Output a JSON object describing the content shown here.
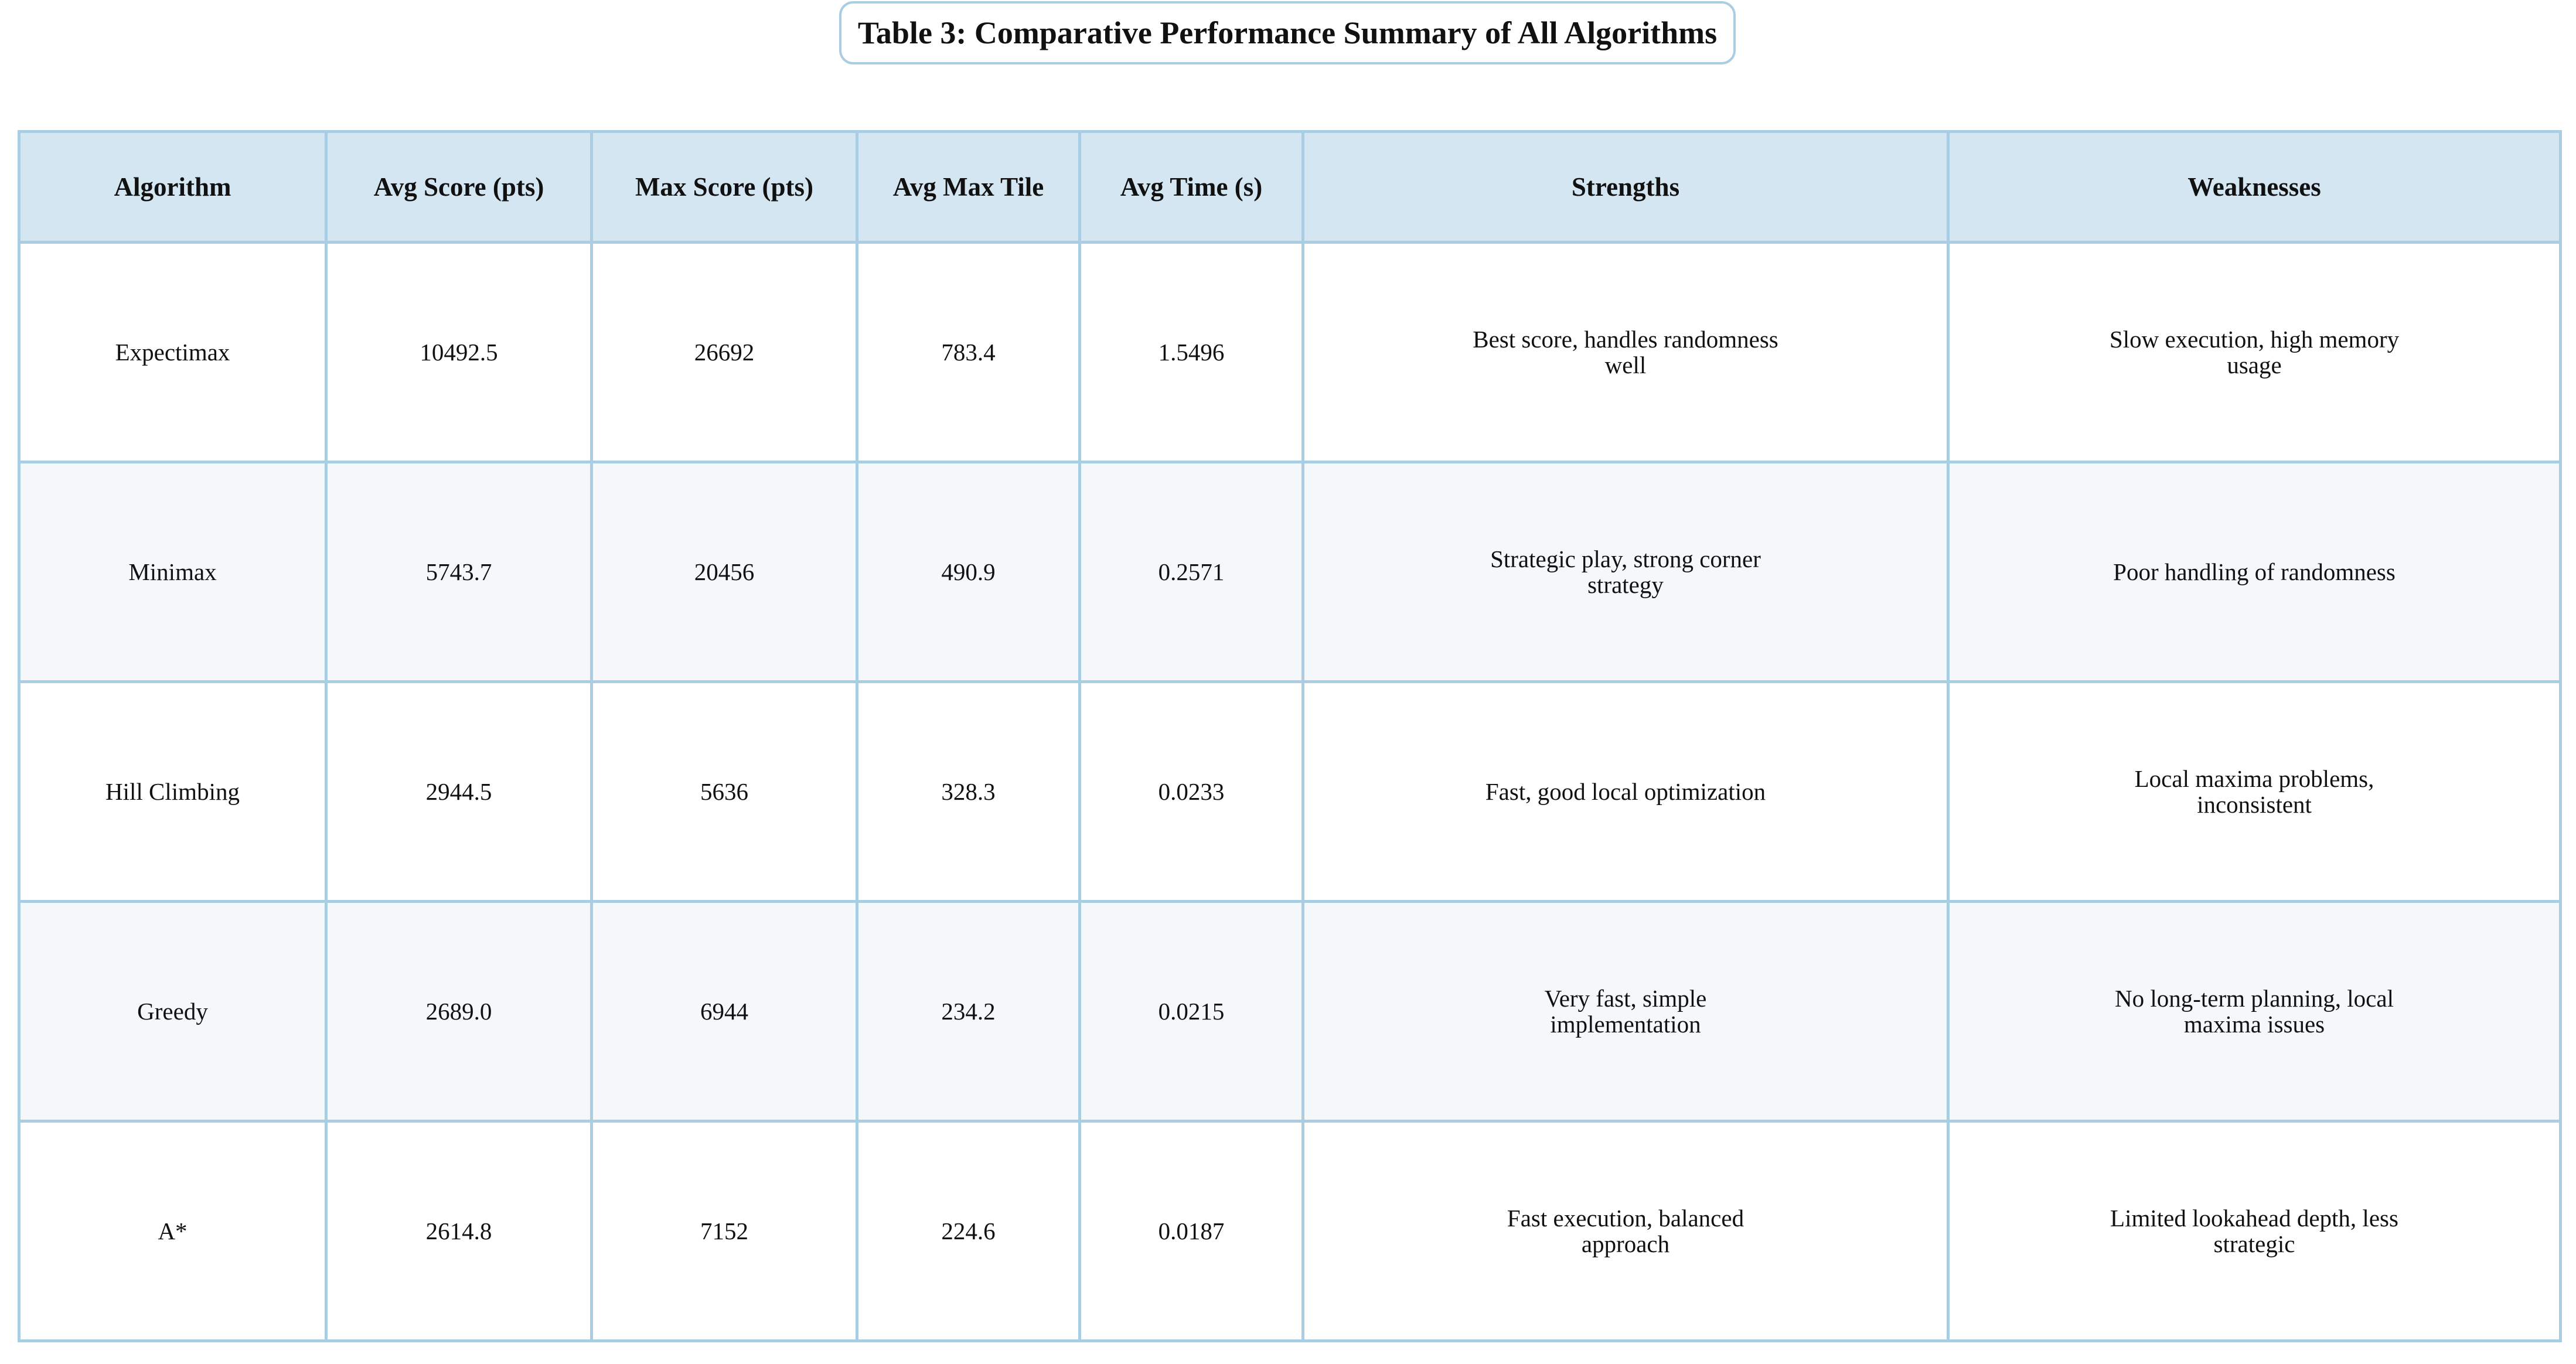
{
  "title": "Table 3: Comparative Performance Summary of All Algorithms",
  "colors": {
    "border": "#a9cde3",
    "header_bg": "#d5e6f3",
    "alt_row_bg": "#f4f8fb"
  },
  "table": {
    "headers": [
      "Algorithm",
      "Avg Score (pts)",
      "Max Score (pts)",
      "Avg Max Tile",
      "Avg Time (s)",
      "Strengths",
      "Weaknesses"
    ],
    "rows": [
      {
        "algorithm": "Expectimax",
        "avg_score": "10492.5",
        "max_score": "26692",
        "avg_max_tile": "783.4",
        "avg_time": "1.5496",
        "strengths": "Best score, handles randomness well",
        "weaknesses": "Slow execution, high memory usage"
      },
      {
        "algorithm": "Minimax",
        "avg_score": "5743.7",
        "max_score": "20456",
        "avg_max_tile": "490.9",
        "avg_time": "0.2571",
        "strengths": "Strategic play, strong corner strategy",
        "weaknesses": "Poor handling of randomness"
      },
      {
        "algorithm": "Hill Climbing",
        "avg_score": "2944.5",
        "max_score": "5636",
        "avg_max_tile": "328.3",
        "avg_time": "0.0233",
        "strengths": "Fast, good local optimization",
        "weaknesses": "Local maxima problems, inconsistent"
      },
      {
        "algorithm": "Greedy",
        "avg_score": "2689.0",
        "max_score": "6944",
        "avg_max_tile": "234.2",
        "avg_time": "0.0215",
        "strengths": "Very fast, simple implementation",
        "weaknesses": "No long-term planning, local maxima issues"
      },
      {
        "algorithm": "A*",
        "avg_score": "2614.8",
        "max_score": "7152",
        "avg_max_tile": "224.6",
        "avg_time": "0.0187",
        "strengths": "Fast execution, balanced approach",
        "weaknesses": "Limited lookahead depth, less strategic"
      }
    ]
  }
}
